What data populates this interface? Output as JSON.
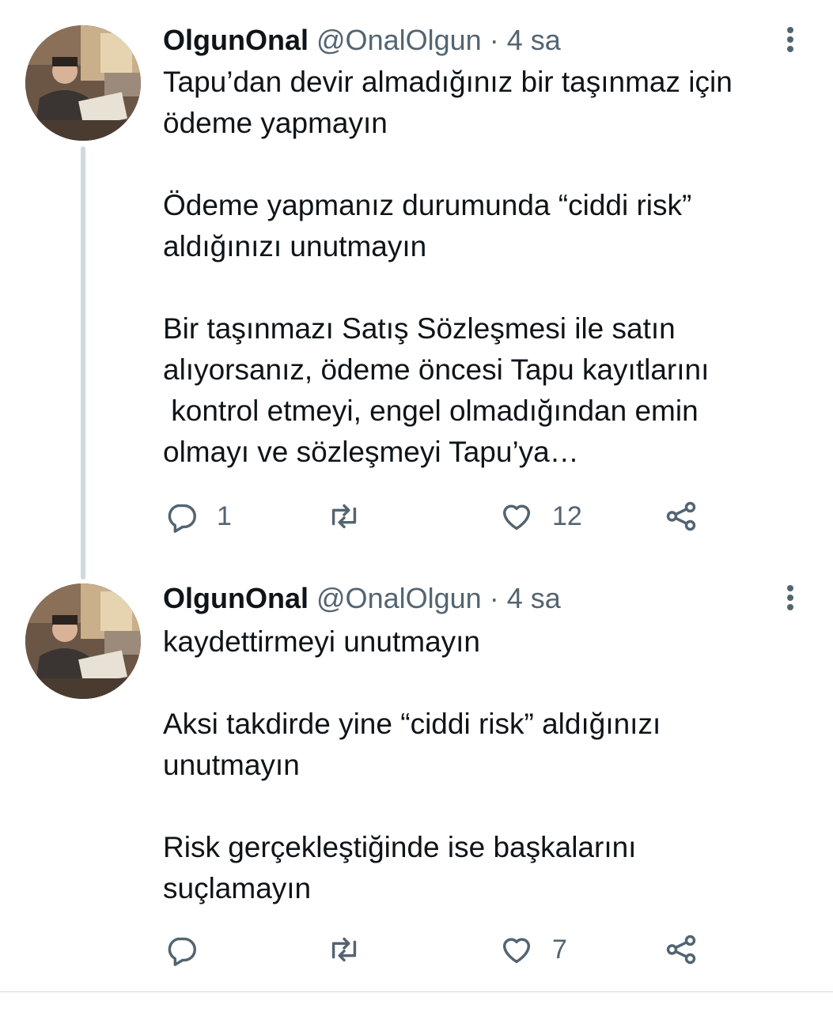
{
  "colors": {
    "text": "#0f1419",
    "secondary": "#536471",
    "thread_line": "#cfd9de"
  },
  "tweets": [
    {
      "display_name": "OlgunOnal",
      "handle": "@OnalOlgun",
      "separator": "·",
      "time": "4 sa",
      "text": "Tapu’dan devir almadığınız bir taşınmaz için\nödeme yapmayın\n\nÖdeme yapmanız durumunda “ciddi risk”\naldığınızı unutmayın\n\nBir taşınmazı Satış Sözleşmesi ile satın\nalıyorsanız, ödeme öncesi Tapu kayıtlarını\n kontrol etmeyi, engel olmadığından emin\nolmayı ve sözleşmeyi Tapu’ya…",
      "reply_count": "1",
      "retweet_count": "",
      "like_count": "12",
      "icons": [
        "reply-icon",
        "retweet-icon",
        "like-icon",
        "share-icon",
        "more-options-icon"
      ]
    },
    {
      "display_name": "OlgunOnal",
      "handle": "@OnalOlgun",
      "separator": "·",
      "time": "4 sa",
      "text": "kaydettirmeyi unutmayın\n\nAksi takdirde yine “ciddi risk” aldığınızı\nunutmayın\n\nRisk gerçekleştiğinde ise başkalarını\nsuçlamayın",
      "reply_count": "",
      "retweet_count": "",
      "like_count": "7",
      "icons": [
        "reply-icon",
        "retweet-icon",
        "like-icon",
        "share-icon",
        "more-options-icon"
      ]
    }
  ]
}
